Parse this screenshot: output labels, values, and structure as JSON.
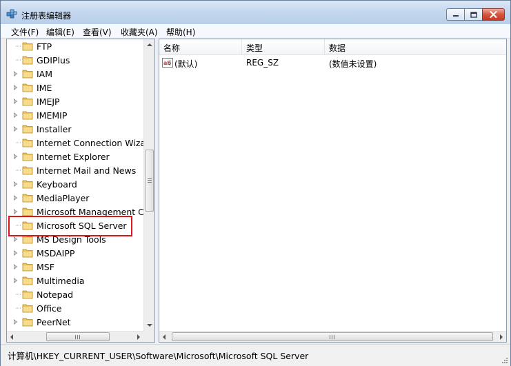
{
  "window": {
    "title": "注册表编辑器"
  },
  "menu": [
    {
      "label": "文件(F)"
    },
    {
      "label": "编辑(E)"
    },
    {
      "label": "查看(V)"
    },
    {
      "label": "收藏夹(A)"
    },
    {
      "label": "帮助(H)"
    }
  ],
  "tree": {
    "items": [
      {
        "label": "FTP",
        "expandable": false
      },
      {
        "label": "GDIPlus",
        "expandable": false
      },
      {
        "label": "IAM",
        "expandable": true
      },
      {
        "label": "IME",
        "expandable": true
      },
      {
        "label": "IMEJP",
        "expandable": true
      },
      {
        "label": "IMEMIP",
        "expandable": true
      },
      {
        "label": "Installer",
        "expandable": true
      },
      {
        "label": "Internet Connection Wizard",
        "expandable": false
      },
      {
        "label": "Internet Explorer",
        "expandable": true
      },
      {
        "label": "Internet Mail and News",
        "expandable": false
      },
      {
        "label": "Keyboard",
        "expandable": true
      },
      {
        "label": "MediaPlayer",
        "expandable": true
      },
      {
        "label": "Microsoft Management Console",
        "expandable": true
      },
      {
        "label": "Microsoft SQL Server",
        "expandable": false,
        "selected": true
      },
      {
        "label": "MS Design Tools",
        "expandable": true
      },
      {
        "label": "MSDAIPP",
        "expandable": true
      },
      {
        "label": "MSF",
        "expandable": true
      },
      {
        "label": "Multimedia",
        "expandable": true
      },
      {
        "label": "Notepad",
        "expandable": false
      },
      {
        "label": "Office",
        "expandable": false
      },
      {
        "label": "PeerNet",
        "expandable": true
      }
    ]
  },
  "list": {
    "columns": [
      {
        "label": "名称"
      },
      {
        "label": "类型"
      },
      {
        "label": "数据"
      }
    ],
    "rows": [
      {
        "name": "(默认)",
        "type": "REG_SZ",
        "data": "(数值未设置)"
      }
    ]
  },
  "statusbar": {
    "path": "计算机\\HKEY_CURRENT_USER\\Software\\Microsoft\\Microsoft SQL Server"
  },
  "colors": {
    "highlight_border": "#e0141b",
    "folder": "#e8c35a",
    "close_button": "#c23a20"
  }
}
